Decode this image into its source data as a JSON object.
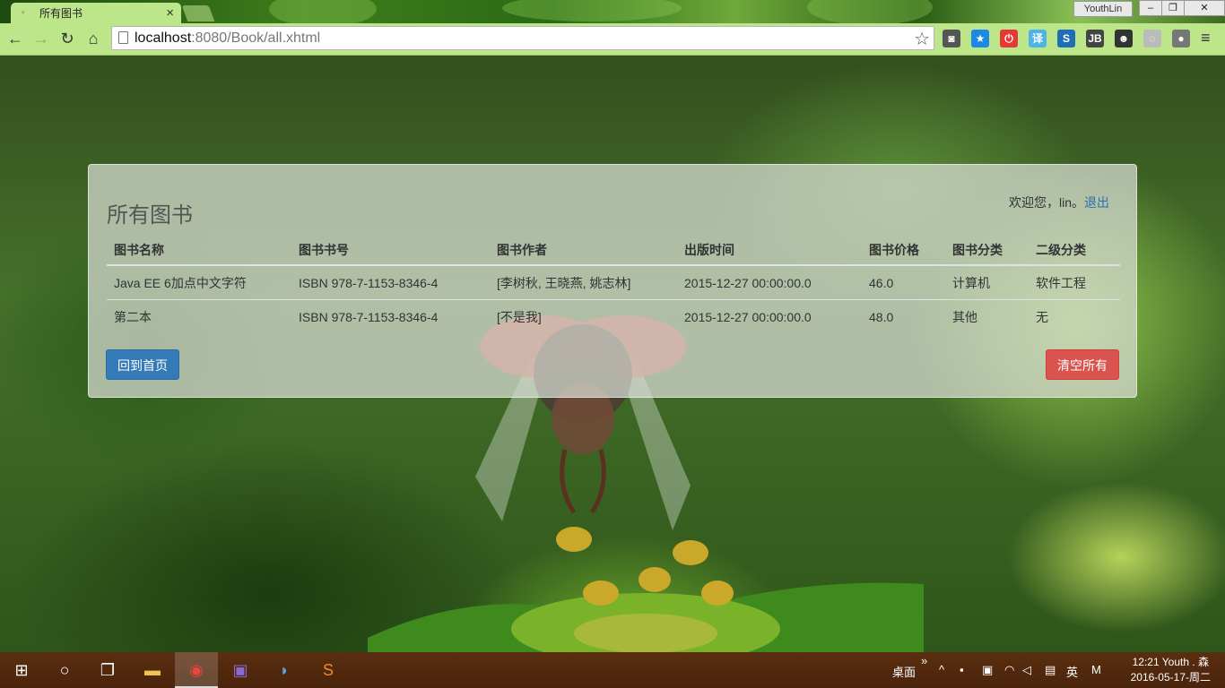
{
  "browser": {
    "tab_title": "所有图书",
    "tab_close": "×",
    "profile_name": "YouthLin",
    "window_controls": {
      "minimize": "–",
      "restore": "❐",
      "close": "✕"
    },
    "url_host": "localhost",
    "url_rest": ":8080/Book/all.xhtml",
    "nav": {
      "back": "←",
      "forward": "→",
      "reload": "↻",
      "home": "⌂"
    },
    "star": "☆",
    "menu": "≡",
    "extensions": [
      {
        "name": "pocket-icon",
        "label": "◙",
        "color": "#555555"
      },
      {
        "name": "bookmark-star-icon",
        "label": "★",
        "color": "#1e88e5"
      },
      {
        "name": "adblock-icon",
        "label": "⏻",
        "color": "#e53935"
      },
      {
        "name": "translate-icon",
        "label": "译",
        "color": "#4fb3e8"
      },
      {
        "name": "s-extension-icon",
        "label": "S",
        "color": "#1e6fb5"
      },
      {
        "name": "jb-extension-icon",
        "label": "JB",
        "color": "#444444"
      },
      {
        "name": "avatar-extension-icon",
        "label": "☻",
        "color": "#333333"
      },
      {
        "name": "ghost-extension-icon",
        "label": "◌",
        "color": "#bbbbbb"
      },
      {
        "name": "drop-extension-icon",
        "label": "●",
        "color": "#777777"
      }
    ]
  },
  "page": {
    "title": "所有图书",
    "welcome_prefix": "欢迎您，lin。",
    "logout_label": "退出",
    "table": {
      "headers": [
        "图书名称",
        "图书书号",
        "图书作者",
        "出版时间",
        "图书价格",
        "图书分类",
        "二级分类"
      ],
      "rows": [
        [
          "Java EE 6加点中文字符",
          "ISBN 978-7-1153-8346-4",
          "[李树秋, 王晓燕, 姚志林]",
          "2015-12-27 00:00:00.0",
          "46.0",
          "计算机",
          "软件工程"
        ],
        [
          "第二本",
          "ISBN 978-7-1153-8346-4",
          "[不是我]",
          "2015-12-27 00:00:00.0",
          "48.0",
          "其他",
          "无"
        ]
      ]
    },
    "back_home_label": "回到首页",
    "clear_all_label": "清空所有"
  },
  "taskbar": {
    "start": "⊞",
    "search": "○",
    "task_view": "❐",
    "apps": [
      {
        "name": "file-explorer-icon",
        "glyph": "▬",
        "color": "#f2c14e"
      },
      {
        "name": "chrome-icon",
        "glyph": "◉",
        "color": "#e8453c"
      },
      {
        "name": "game-app-icon",
        "glyph": "▣",
        "color": "#8a6bd1"
      },
      {
        "name": "dolphin-app-icon",
        "glyph": "◗",
        "color": "#5aa0e0"
      },
      {
        "name": "sublime-text-icon",
        "glyph": "S",
        "color": "#f08a24"
      }
    ],
    "desktop_label": "桌面",
    "desktop_chevron": "»",
    "tray_caret": "^",
    "ime_label": "英",
    "m_label": "M",
    "clock_time": "12:21 Youth . 森",
    "clock_date": "2016-05-17-周二"
  }
}
